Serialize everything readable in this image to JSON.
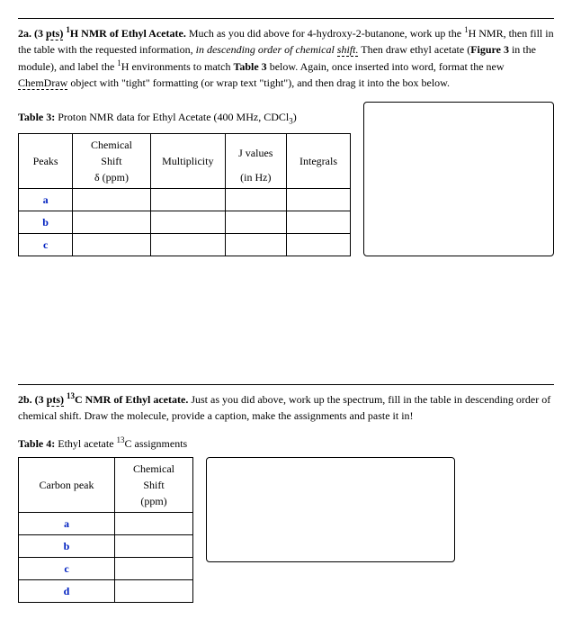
{
  "sec2a": {
    "heading_lead": "2a. (3 ",
    "heading_pts": "pts)",
    "heading_space": " ",
    "heading_super": "1",
    "heading_title_rest": "H NMR of Ethyl Acetate.",
    "body1": " Much as you did above for 4-hydroxy-2-butanone, work up the ",
    "sup1": "1",
    "body1b": "H NMR, then fill in the table with the requested information, ",
    "body_ital": "in descending order of chemical ",
    "body_ital_dash": "shift.",
    "body2": " Then draw ethyl acetate (",
    "fig_bold": "Figure 3",
    "body3": " in the module), and label the ",
    "sup2": "1",
    "body3b": "H environments to match ",
    "tbl_bold": "Table 3",
    "body4": " below.  Again, once inserted into word, format the new ",
    "chemdraw": "ChemDraw",
    "body5": " object with \"tight\" formatting (or wrap text \"tight\"), and then drag it into the box below.",
    "table_caption_bold": "Table 3:",
    "table_caption_rest_a": " Proton NMR data for Ethyl Acetate (400 MHz, CDCl",
    "table_caption_sub": "3",
    "table_caption_rest_b": ")",
    "headers": {
      "peaks": "Peaks",
      "cs_top": "Chemical Shift",
      "cs_bot": "δ (ppm)",
      "mult": "Multiplicity",
      "j_top": "J values",
      "j_bot": "(in Hz)",
      "integ": "Integrals"
    },
    "rows": [
      "a",
      "b",
      "c"
    ]
  },
  "sec2b": {
    "heading_lead": "2b. (3 ",
    "heading_pts": "pts)",
    "heading_space": " ",
    "heading_super": "13",
    "heading_title_rest": "C NMR of Ethyl acetate.",
    "body": "  Just as you did above, work up the spectrum, fill in the table in descending order of chemical shift. Draw the molecule, provide a caption, make the assignments and paste it in!",
    "table_caption_bold": "Table 4:",
    "table_caption_rest_a": " Ethyl acetate ",
    "table_caption_sup": "13",
    "table_caption_rest_b": "C assignments",
    "headers": {
      "cp": "Carbon peak",
      "cs1": "Chemical",
      "cs2": "Shift",
      "cs3": "(ppm)"
    },
    "rows": [
      "a",
      "b",
      "c",
      "d"
    ]
  }
}
